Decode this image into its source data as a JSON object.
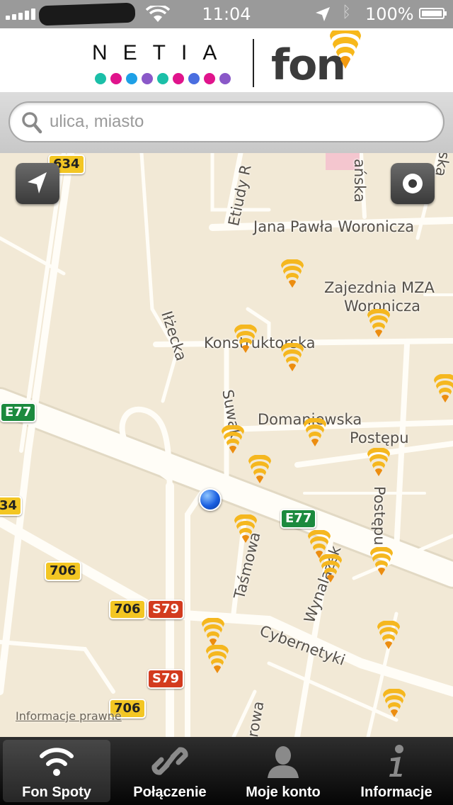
{
  "status_bar": {
    "time": "11:04",
    "battery": "100%",
    "signal_bars": 5
  },
  "header": {
    "netia_wordmark": "NETIA",
    "fon_wordmark": "fon",
    "dot_colors": [
      "#1bbfa8",
      "#e0148c",
      "#1ea0e6",
      "#8a58c8",
      "#1bbfa8",
      "#e0148c",
      "#4a6ee0",
      "#e0148c",
      "#8a58c8"
    ]
  },
  "search": {
    "placeholder": "ulica, miasto"
  },
  "map": {
    "street_labels": {
      "jana_pawla": "Jana Pawła Woroniczа",
      "zajezdnia_1": "Zajezdnia MZA",
      "zajezdnia_2": "Woronicza",
      "konstruktorska": "Konstruktorska",
      "domaniewska": "Domaniewska",
      "postepu": "Postępu",
      "postepu_v": "Postępu",
      "suwak": "Suwak",
      "ilzecka": "Iłżecka",
      "etiudy": "Etiudy R",
      "tasmowa": "Taśmowa",
      "wynalazek": "Wynalazek",
      "cybernetyki": "Cybernetyki",
      "anska": "ańska",
      "rowa": "rowa",
      "ska": "ska"
    },
    "road_shields": {
      "s634": "634",
      "s34": "34",
      "e77_left": "E77",
      "e77_mid": "E77",
      "r706_a": "706",
      "r706_b": "706",
      "r706_c": "706",
      "s79_a": "S79",
      "s79_b": "S79"
    },
    "legal_link": "Informacje prawne",
    "hotspot_icon": "fon-hotspot-icon",
    "locate_button_icon": "location-arrow-icon",
    "record_button_icon": "record-dot-icon"
  },
  "tabs": [
    {
      "label": "Fon Spoty",
      "icon": "wifi-icon",
      "selected": true
    },
    {
      "label": "Połączenie",
      "icon": "link-icon",
      "selected": false
    },
    {
      "label": "Moje konto",
      "icon": "person-icon",
      "selected": false
    },
    {
      "label": "Informacje",
      "icon": "info-icon",
      "selected": false
    }
  ]
}
